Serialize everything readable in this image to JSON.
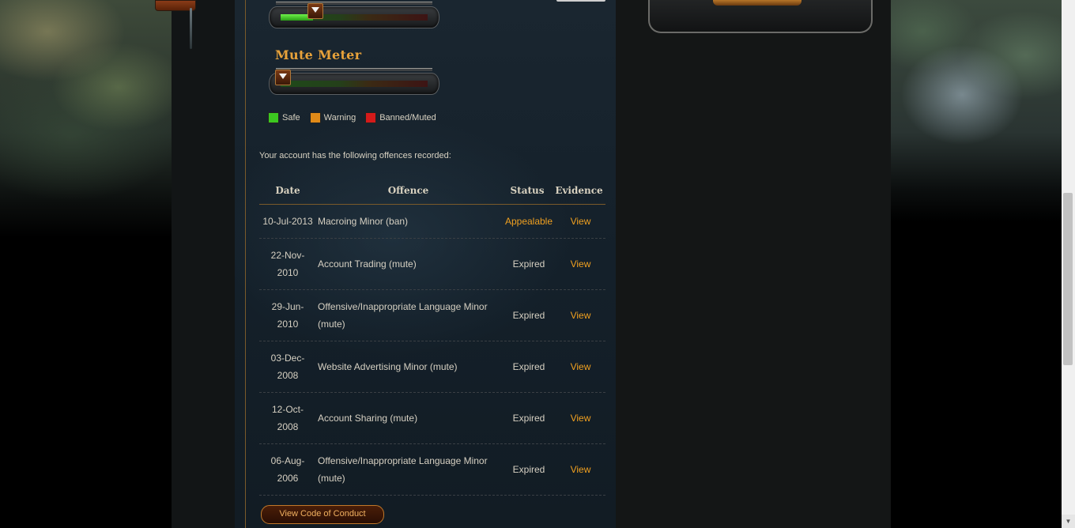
{
  "meters": {
    "upper_meter_level": 0.22,
    "mute_meter_title": "Mute Meter",
    "mute_meter_level": 0.0
  },
  "legend": [
    {
      "label": "Safe",
      "color": "#3cc820"
    },
    {
      "label": "Warning",
      "color": "#e08a18"
    },
    {
      "label": "Banned/Muted",
      "color": "#d41a1a"
    }
  ],
  "intro_text": "Your account has the following offences recorded:",
  "table": {
    "headers": {
      "date": "Date",
      "offence": "Offence",
      "status": "Status",
      "evidence": "Evidence"
    },
    "rows": [
      {
        "date": "10-Jul-2013",
        "offence": "Macroing Minor (ban)",
        "status": "Appealable",
        "evidence": "View"
      },
      {
        "date": "22-Nov-2010",
        "offence": "Account Trading (mute)",
        "status": "Expired",
        "evidence": "View"
      },
      {
        "date": "29-Jun-2010",
        "offence": "Offensive/Inappropriate Language Minor (mute)",
        "status": "Expired",
        "evidence": "View"
      },
      {
        "date": "03-Dec-2008",
        "offence": "Website Advertising Minor (mute)",
        "status": "Expired",
        "evidence": "View"
      },
      {
        "date": "12-Oct-2008",
        "offence": "Account Sharing (mute)",
        "status": "Expired",
        "evidence": "View"
      },
      {
        "date": "06-Aug-2006",
        "offence": "Offensive/Inappropriate Language Minor (mute)",
        "status": "Expired",
        "evidence": "View"
      }
    ]
  },
  "buttons": {
    "code_of_conduct": "View Code of Conduct"
  },
  "colors": {
    "accent": "#f0a020",
    "panel": "#162330"
  }
}
